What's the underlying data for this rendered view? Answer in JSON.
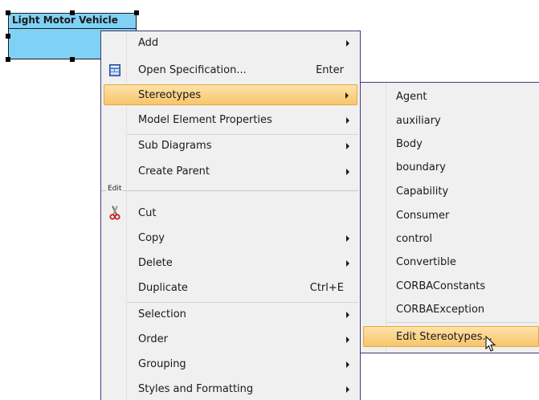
{
  "diagram": {
    "class_name": "Light Motor Vehicle",
    "class_fill": "#7fd2f5"
  },
  "context_menu": {
    "items": [
      {
        "label": "Add",
        "has_submenu": true
      },
      {
        "label": "Open Specification...",
        "shortcut": "Enter",
        "icon": "specification-icon"
      },
      {
        "label": "Stereotypes",
        "has_submenu": true,
        "highlighted": true
      },
      {
        "label": "Model Element Properties",
        "has_submenu": true
      },
      {
        "label": "Sub Diagrams",
        "has_submenu": true
      },
      {
        "label": "Create Parent",
        "has_submenu": true
      },
      {
        "label": "Cut",
        "icon": "scissors-icon"
      },
      {
        "label": "Copy",
        "has_submenu": true
      },
      {
        "label": "Delete",
        "has_submenu": true
      },
      {
        "label": "Duplicate",
        "shortcut": "Ctrl+E"
      },
      {
        "label": "Selection",
        "has_submenu": true
      },
      {
        "label": "Order",
        "has_submenu": true
      },
      {
        "label": "Grouping",
        "has_submenu": true
      },
      {
        "label": "Styles and Formatting",
        "has_submenu": true
      }
    ],
    "section_edit": "Edit"
  },
  "stereotypes_submenu": {
    "items": [
      {
        "label": "Agent"
      },
      {
        "label": "auxiliary"
      },
      {
        "label": "Body"
      },
      {
        "label": "boundary"
      },
      {
        "label": "Capability"
      },
      {
        "label": "Consumer"
      },
      {
        "label": "control"
      },
      {
        "label": "Convertible"
      },
      {
        "label": "CORBAConstants"
      },
      {
        "label": "CORBAException"
      },
      {
        "label": "Edit Stereotypes...",
        "highlighted": true
      }
    ]
  },
  "colors": {
    "menu_bg": "#f0f0f0",
    "menu_border": "#3c3c7a",
    "highlight_top": "#fde3a8",
    "highlight_bottom": "#f7c56c",
    "highlight_border": "#e3a83b"
  }
}
